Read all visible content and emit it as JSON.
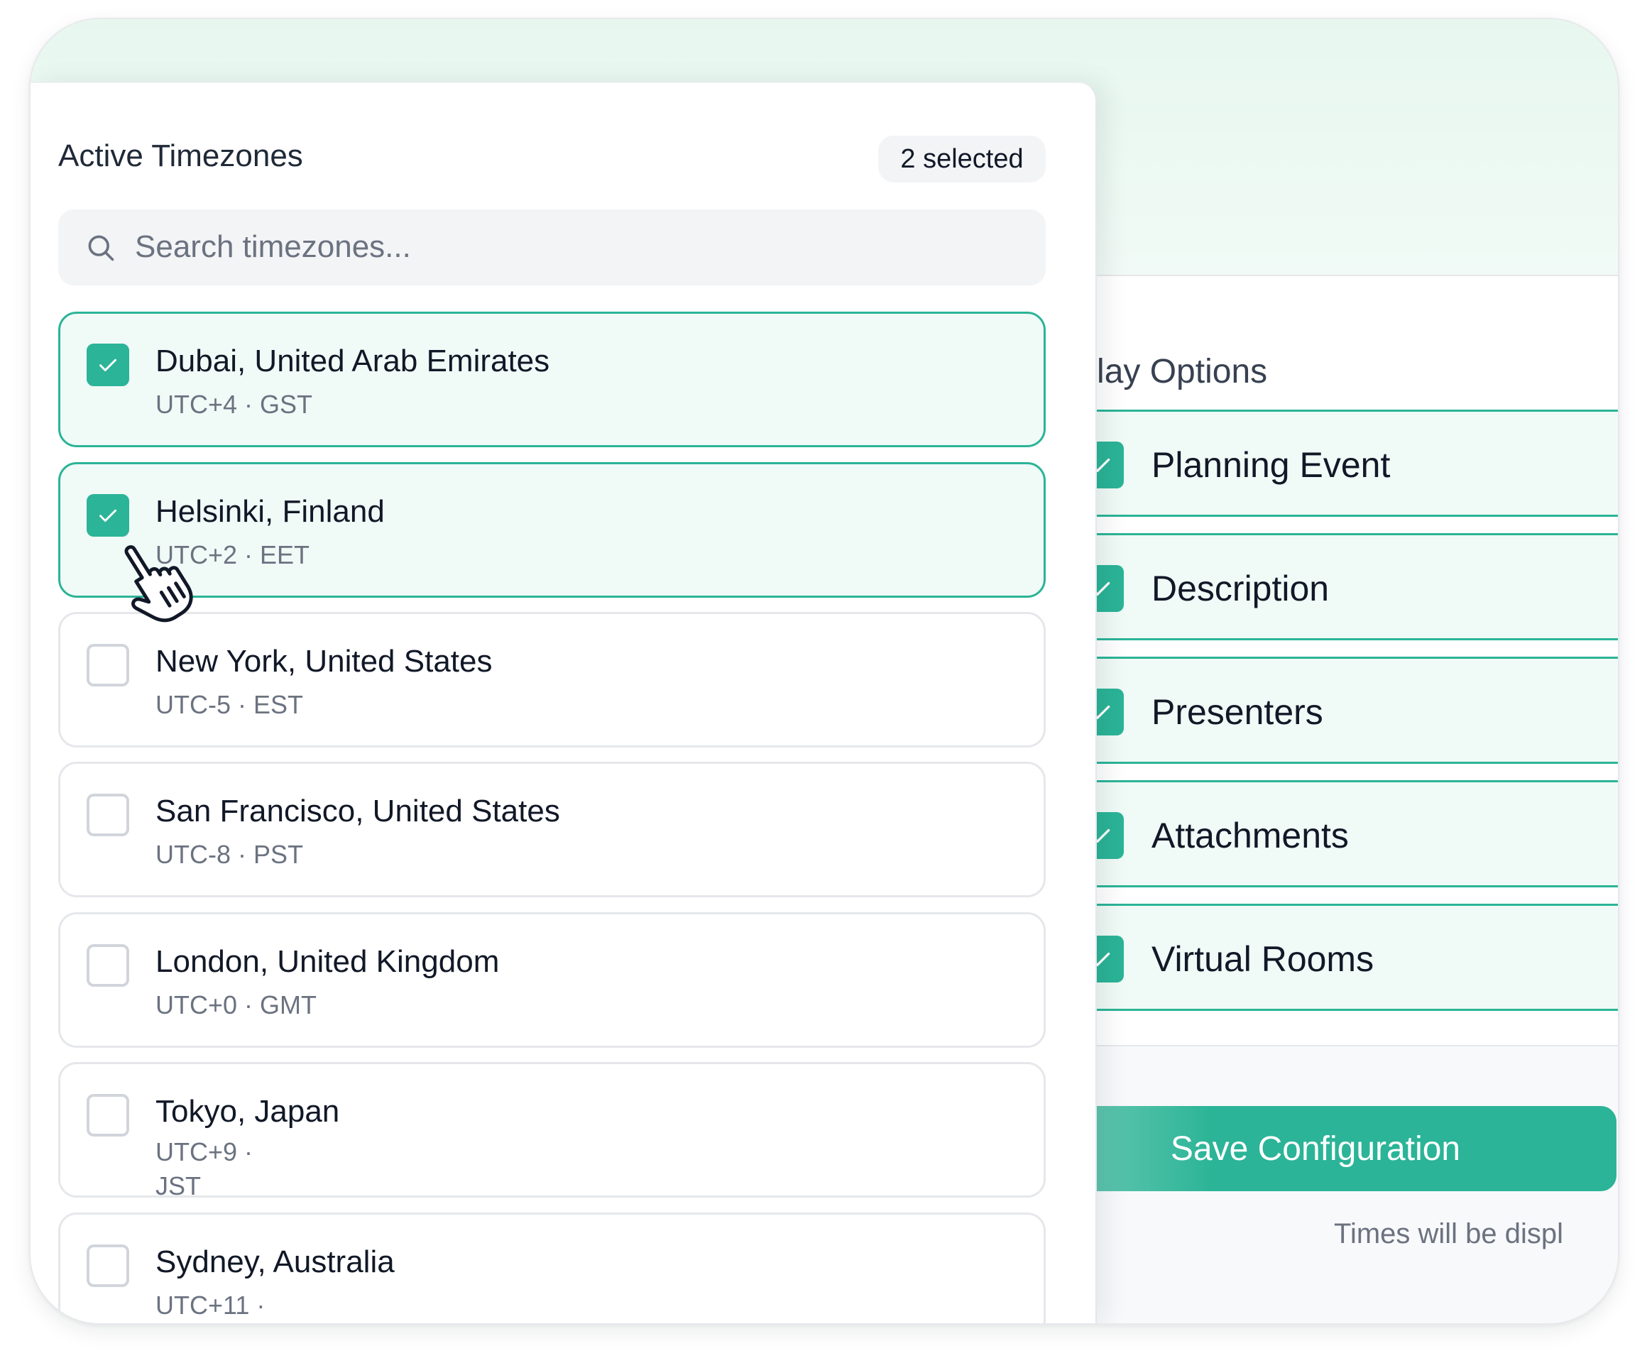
{
  "colors": {
    "accent": "#2bb497",
    "accent_light": "#f0faf7",
    "band": "#e7f7ef"
  },
  "timezones_panel": {
    "title": "Active Timezones",
    "selected_badge": "2 selected",
    "search": {
      "placeholder": "Search timezones...",
      "value": "",
      "icon": "search-icon"
    },
    "items": [
      {
        "city": "Dubai, United Arab Emirates",
        "offset": "UTC+4 · GST",
        "checked": true
      },
      {
        "city": "Helsinki, Finland",
        "offset": "UTC+2 · EET",
        "checked": true
      },
      {
        "city": "New York, United States",
        "offset": "UTC-5 · EST",
        "checked": false
      },
      {
        "city": "San Francisco, United States",
        "offset": "UTC-8 · PST",
        "checked": false
      },
      {
        "city": "London, United Kingdom",
        "offset": "UTC+0 · GMT",
        "checked": false
      },
      {
        "city": "Tokyo, Japan",
        "offset": "UTC+9 · JST",
        "checked": false
      },
      {
        "city": "Sydney, Australia",
        "offset": "UTC+11 ·",
        "checked": false
      }
    ]
  },
  "display_options": {
    "title": "Display Options",
    "items": [
      {
        "label": "Planning Event",
        "checked": true
      },
      {
        "label": "Description",
        "checked": true
      },
      {
        "label": "Presenters",
        "checked": true
      },
      {
        "label": "Attachments",
        "checked": true
      },
      {
        "label": "Virtual Rooms",
        "checked": true
      }
    ]
  },
  "save_button": {
    "label": "Save Configuration"
  },
  "footnote": "Times will be displ",
  "cursor": {
    "icon": "hand-pointer-icon"
  }
}
